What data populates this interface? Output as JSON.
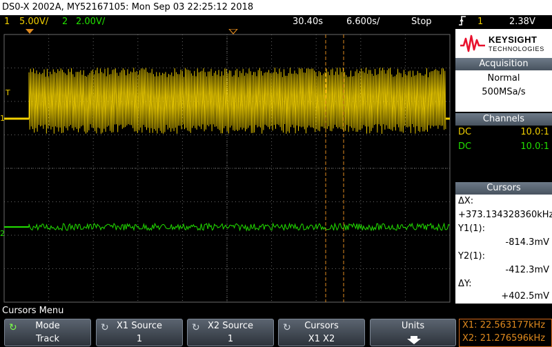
{
  "title": "DS0-X 2002A, MY52167105: Mon Sep 03 22:25:12 2018",
  "status": {
    "ch1_num": "1",
    "ch1_scale": "5.00V/",
    "ch2_num": "2",
    "ch2_scale": "2.00V/",
    "time_offset": "30.40s",
    "time_scale": "6.600s/",
    "run_state": "Stop",
    "trigger_icon": "trigger-edge-icon",
    "trigger_source": "1",
    "trigger_level": "2.38V"
  },
  "brand": {
    "name": "KEYSIGHT",
    "subtitle": "TECHNOLOGIES"
  },
  "acquisition": {
    "header": "Acquisition",
    "mode": "Normal",
    "rate": "500MSa/s"
  },
  "channels": {
    "header": "Channels",
    "rows": [
      {
        "coupling": "DC",
        "probe": "10.0:1",
        "color": "#f2d000"
      },
      {
        "coupling": "DC",
        "probe": "10.0:1",
        "color": "#22e000"
      }
    ]
  },
  "cursors": {
    "header": "Cursors",
    "dx_label": "ΔX:",
    "dx_value": "+373.134328360kHz",
    "y1_label": "Y1(1):",
    "y1_value": "-814.3mV",
    "y2_label": "Y2(1):",
    "y2_value": "-412.3mV",
    "dy_label": "ΔY:",
    "dy_value": "+402.5mV"
  },
  "menu": {
    "title": "Cursors Menu",
    "softkeys": [
      {
        "label": "Mode",
        "value": "Track",
        "icon": "rotate-knob-icon"
      },
      {
        "label": "X1 Source",
        "value": "1",
        "icon": "rotate-knob-icon"
      },
      {
        "label": "X2 Source",
        "value": "1",
        "icon": "rotate-knob-icon"
      },
      {
        "label": "Cursors",
        "value": "X1 X2",
        "icon": "rotate-knob-icon"
      },
      {
        "label": "Units",
        "value": "",
        "icon": "down-arrow-icon"
      }
    ]
  },
  "readout": {
    "x1": "X1: 22.563177kHz",
    "x2": "X2: 21.276596kHz"
  },
  "markers": {
    "trigger_marker": "T",
    "ch1_marker": "1",
    "ch2_marker": "2"
  },
  "colors": {
    "ch1": "#f2d000",
    "ch2": "#22e000",
    "cursor": "#e08a1e",
    "grid": "#6b6b6b"
  }
}
